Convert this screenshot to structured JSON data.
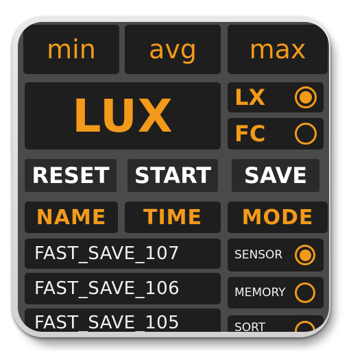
{
  "stats": {
    "min": "min",
    "avg": "avg",
    "max": "max"
  },
  "display": {
    "unit_label": "LUX"
  },
  "units": [
    {
      "label": "LX",
      "selected": true
    },
    {
      "label": "FC",
      "selected": false
    }
  ],
  "buttons": {
    "reset": "RESET",
    "start": "START",
    "save": "SAVE"
  },
  "columns": {
    "name": "NAME",
    "time": "TIME",
    "mode": "MODE"
  },
  "saves": [
    {
      "name": "FAST_SAVE_107",
      "time": ""
    },
    {
      "name": "FAST_SAVE_106",
      "time": ""
    },
    {
      "name": "FAST_SAVE_105",
      "time": ""
    }
  ],
  "modes": [
    {
      "label": "SENSOR",
      "selected": true
    },
    {
      "label": "MEMORY",
      "selected": false
    },
    {
      "label": "SORT",
      "selected": false
    }
  ],
  "colors": {
    "accent": "#f39a1a",
    "panel": "#4a4a4a",
    "cell": "#1e1e1e",
    "text": "#f2f2f2"
  }
}
